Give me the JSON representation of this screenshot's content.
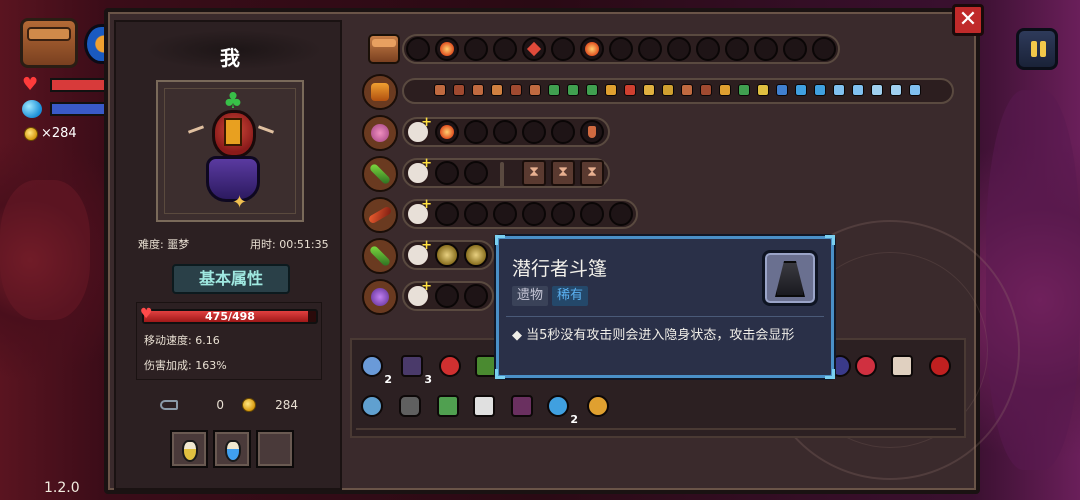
{
  "hud": {
    "coins": "×284",
    "version": "1.2.0"
  },
  "character": {
    "name": "我",
    "difficulty": "难度: 噩梦",
    "time": "用时: 00:51:35",
    "attributes_button": "基本属性",
    "hp_text": "475/498",
    "hp_fraction": 0.954,
    "move_speed": "移动速度: 6.16",
    "damage_bonus": "伤害加成: 163%",
    "keys": "0",
    "gold": "284"
  },
  "tooltip": {
    "title": "潜行者斗篷",
    "tag_type": "遗物",
    "tag_rarity": "稀有",
    "description": "◆ 当5秒没有攻击则会进入隐身状态，攻击会显形"
  },
  "relic_counts": {
    "relic_1": "2",
    "relic_2": "3",
    "relic_3": "2"
  },
  "colors": {
    "panel": "#3a2a2c",
    "tooltip_bg": "#2a3048",
    "tooltip_border": "#4a90c8",
    "hp": "#e04040",
    "rarity_tag": "#5ab0f0"
  }
}
